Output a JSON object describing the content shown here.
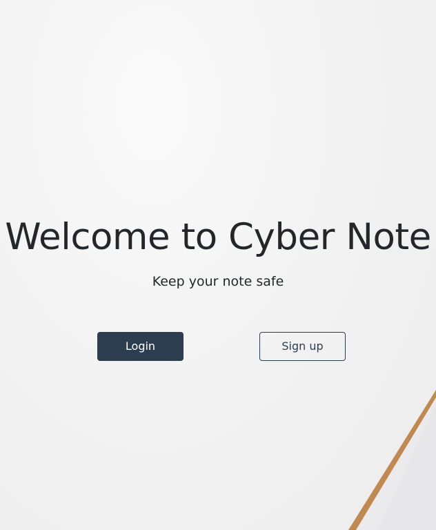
{
  "hero": {
    "title": "Welcome to Cyber Note",
    "subtitle": "Keep your note safe"
  },
  "actions": {
    "login_label": "Login",
    "signup_label": "Sign up"
  },
  "colors": {
    "text": "#23272b",
    "primary": "#2d3d50",
    "background": "#f1f1f1"
  }
}
